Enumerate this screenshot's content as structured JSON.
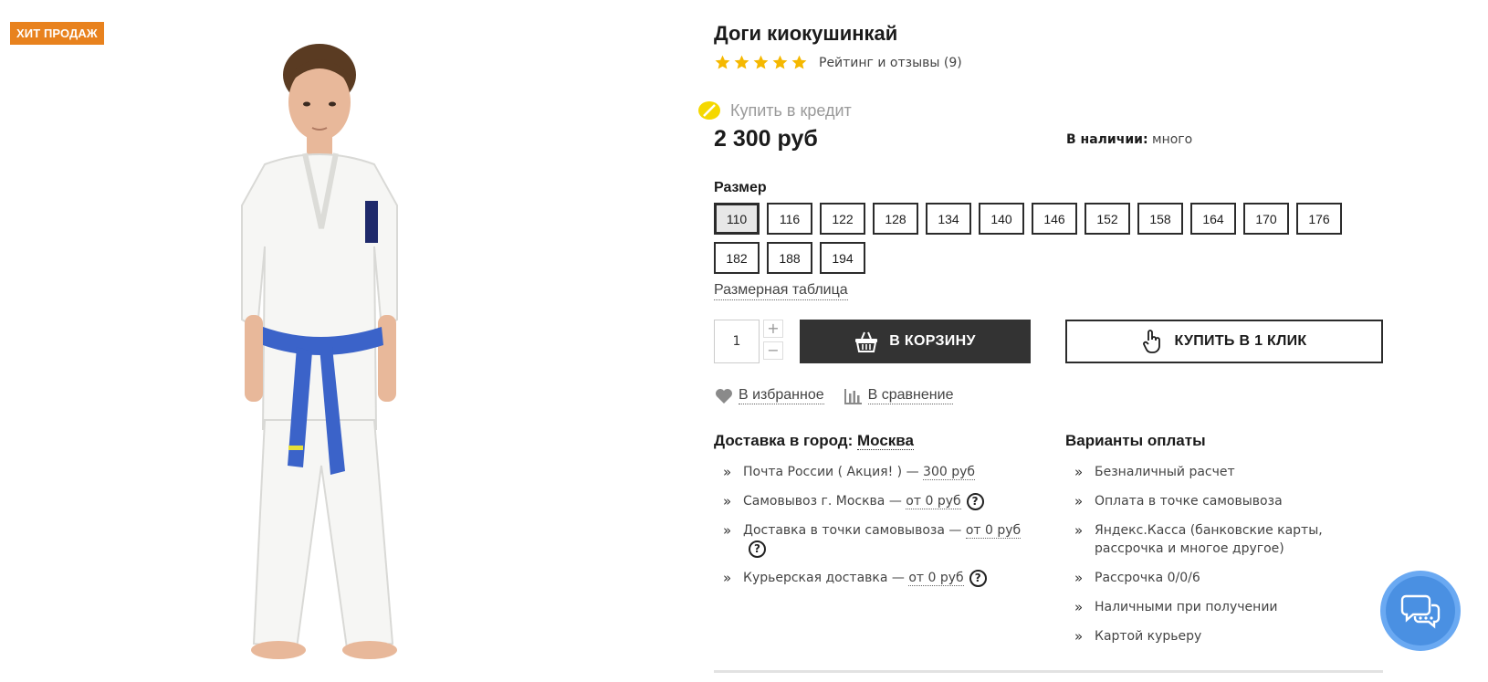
{
  "badge": "ХИТ ПРОДАЖ",
  "product": {
    "title": "Доги киокушинкай",
    "rating_stars": 5,
    "rating_link": "Рейтинг и отзывы (9)",
    "credit_text": "Купить в кредит",
    "price": "2 300 руб",
    "stock_label": "В наличии:",
    "stock_value": "много"
  },
  "sizes": {
    "label": "Размер",
    "options": [
      "110",
      "116",
      "122",
      "128",
      "134",
      "140",
      "146",
      "152",
      "158",
      "164",
      "170",
      "176",
      "182",
      "188",
      "194"
    ],
    "selected": "110",
    "table_link": "Размерная таблица"
  },
  "purchase": {
    "quantity": "1",
    "plus": "+",
    "minus": "−",
    "cart_label": "В КОРЗИНУ",
    "oneclick_label": "КУПИТЬ В 1 КЛИК"
  },
  "actions": {
    "favorite": "В избранное",
    "compare": "В сравнение"
  },
  "delivery": {
    "title_prefix": "Доставка в город:",
    "city": "Москва",
    "items": [
      {
        "text": "Почта России ( Акция! ) —",
        "price": "300 руб",
        "help": false
      },
      {
        "text": "Самовывоз г. Москва —",
        "price": "от 0 руб",
        "help": true
      },
      {
        "text": "Доставка в точки самовывоза —",
        "price": "от 0 руб",
        "help": true
      },
      {
        "text": "Курьерская доставка —",
        "price": "от 0 руб",
        "help": true
      }
    ]
  },
  "payment": {
    "title": "Варианты оплаты",
    "items": [
      "Безналичный расчет",
      "Оплата в точке самовывоза",
      "Яндекс.Касса (банковские карты, рассрочка и многое другое)",
      "Рассрочка 0/0/6",
      "Наличными при получении",
      "Картой курьеру"
    ]
  },
  "colors": {
    "badge": "#e8821e",
    "stars": "#f5b800",
    "cart_button": "#333333",
    "chat": "#4a90e2",
    "belt": "#3b63c9"
  },
  "icons": {
    "star": "star-icon",
    "credit": "credit-coin-icon",
    "cart": "basket-icon",
    "oneclick": "hand-pointer-icon",
    "favorite": "heart-icon",
    "compare": "bar-chart-icon",
    "help": "question-icon",
    "chat": "chat-bubbles-icon"
  }
}
